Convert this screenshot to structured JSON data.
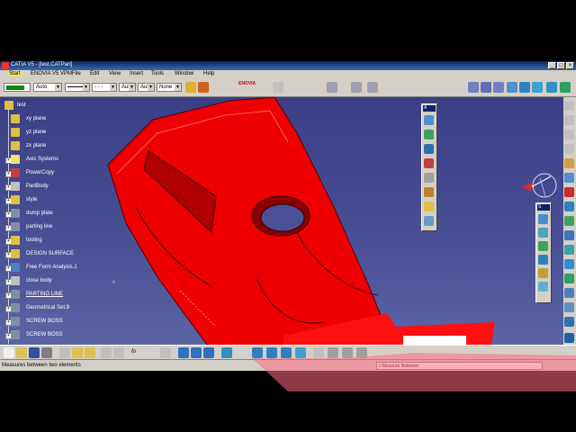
{
  "window": {
    "title": "CATIA V5 - [test.CATPart]"
  },
  "menu": [
    "Start",
    "ENOVIA V5 VPM",
    "File",
    "Edit",
    "View",
    "Insert",
    "Tools",
    "Window",
    "Help"
  ],
  "properties_bar": {
    "line_weight": "Auto",
    "lt1": "- - -",
    "lt2": "Aut",
    "lt3": "Aut",
    "layer": "None"
  },
  "enovia_logo": "ENOVIA",
  "tree": {
    "root": "test",
    "items": [
      {
        "label": "xy plane",
        "icon": "plane-icon",
        "color": "#e0c040"
      },
      {
        "label": "yz plane",
        "icon": "plane-icon",
        "color": "#e0c040"
      },
      {
        "label": "zx plane",
        "icon": "plane-icon",
        "color": "#e0c040"
      },
      {
        "label": "Axis Systems",
        "icon": "axis-system-icon",
        "color": "#f0e070"
      },
      {
        "label": "PowerCopy",
        "icon": "powercopy-icon",
        "color": "#c04040"
      },
      {
        "label": "PartBody",
        "icon": "partbody-icon",
        "color": "#c0c0c0"
      },
      {
        "label": "style",
        "icon": "gear-icon",
        "color": "#e0c040"
      },
      {
        "label": "dump plate",
        "icon": "geometrical-set-icon",
        "color": "#8090a0"
      },
      {
        "label": "parting line",
        "icon": "geometrical-set-icon",
        "color": "#8090a0"
      },
      {
        "label": "tooling",
        "icon": "gear-icon",
        "color": "#e0c040"
      },
      {
        "label": "DESIGN SURFACE",
        "icon": "gear-icon",
        "color": "#e0c040"
      },
      {
        "label": "Free Form Analysis.1",
        "icon": "analysis-icon",
        "color": "#5080c0"
      },
      {
        "label": "close body",
        "icon": "body-icon",
        "color": "#c0c0c0"
      },
      {
        "label": "PARTING LINE",
        "icon": "geometrical-set-icon",
        "color": "#8090a0",
        "underline": true
      },
      {
        "label": "Geometrical Set.9",
        "icon": "geometrical-set-icon",
        "color": "#8090a0"
      },
      {
        "label": "SCREW BOSS",
        "icon": "geometrical-set-icon",
        "color": "#8090a0"
      },
      {
        "label": "SCREW BOSS",
        "icon": "geometrical-set-icon",
        "color": "#8090a0"
      }
    ]
  },
  "float_toolbar_1": {
    "title": "A"
  },
  "float_toolbar_2": {
    "title": "S"
  },
  "bottom_toolbar": {
    "fo": "fo"
  },
  "status": {
    "message": "Measures between two elements",
    "command": "c:Measure Between"
  },
  "colors": {
    "part_red": "#ee0000",
    "viewport_top": "#3b3e84",
    "viewport_bottom": "#5c67a5"
  }
}
